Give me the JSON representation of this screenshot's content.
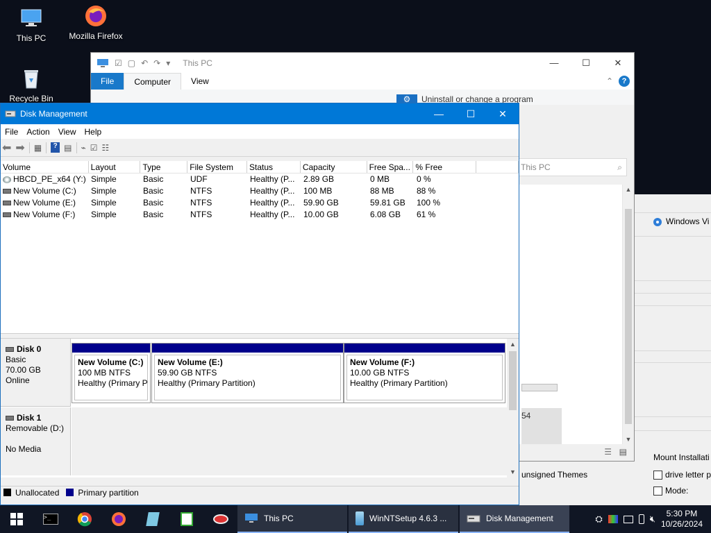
{
  "desktop": {
    "icons": [
      {
        "label": "This PC"
      },
      {
        "label": "Mozilla Firefox"
      },
      {
        "label": "Recycle Bin"
      }
    ]
  },
  "explorer": {
    "title": "This PC",
    "ribbon_tabs": [
      "File",
      "Computer",
      "View"
    ],
    "uninstall_label": "Uninstall or change a program",
    "search_placeholder": "This PC",
    "partial_text": "54"
  },
  "winntsetup": {
    "windows_label": "Windows Vi"
  },
  "bg_options": {
    "unsigned_themes": "unsigned Themes",
    "mount_label": "Mount Installati",
    "drive_letter_label": "drive letter p",
    "mode_label": "Mode:"
  },
  "diskmgmt": {
    "title": "Disk Management",
    "menu": [
      "File",
      "Action",
      "View",
      "Help"
    ],
    "columns": [
      "Volume",
      "Layout",
      "Type",
      "File System",
      "Status",
      "Capacity",
      "Free Spa...",
      "% Free",
      ""
    ],
    "volumes": [
      {
        "name": "HBCD_PE_x64 (Y:)",
        "layout": "Simple",
        "type": "Basic",
        "fs": "UDF",
        "status": "Healthy (P...",
        "capacity": "2.89 GB",
        "free": "0 MB",
        "pct": "0 %",
        "icon": "cd"
      },
      {
        "name": "New Volume (C:)",
        "layout": "Simple",
        "type": "Basic",
        "fs": "NTFS",
        "status": "Healthy (P...",
        "capacity": "100 MB",
        "free": "88 MB",
        "pct": "88 %",
        "icon": "drive"
      },
      {
        "name": "New Volume (E:)",
        "layout": "Simple",
        "type": "Basic",
        "fs": "NTFS",
        "status": "Healthy (P...",
        "capacity": "59.90 GB",
        "free": "59.81 GB",
        "pct": "100 %",
        "icon": "drive"
      },
      {
        "name": "New Volume (F:)",
        "layout": "Simple",
        "type": "Basic",
        "fs": "NTFS",
        "status": "Healthy (P...",
        "capacity": "10.00 GB",
        "free": "6.08 GB",
        "pct": "61 %",
        "icon": "drive"
      }
    ],
    "disks": [
      {
        "name": "Disk 0",
        "kind": "Basic",
        "size": "70.00 GB",
        "state": "Online",
        "partitions": [
          {
            "name": "New Volume  (C:)",
            "size": "100 MB NTFS",
            "status": "Healthy (Primary P"
          },
          {
            "name": "New Volume  (E:)",
            "size": "59.90 GB NTFS",
            "status": "Healthy (Primary Partition)"
          },
          {
            "name": "New Volume  (F:)",
            "size": "10.00 GB NTFS",
            "status": "Healthy (Primary Partition)"
          }
        ]
      },
      {
        "name": "Disk 1",
        "kind": "Removable (D:)",
        "size": "",
        "state": "No Media"
      }
    ],
    "legend": [
      {
        "label": "Unallocated",
        "color": "#000000"
      },
      {
        "label": "Primary partition",
        "color": "#00008b"
      }
    ]
  },
  "taskbar": {
    "apps": [
      {
        "label": "This PC"
      },
      {
        "label": "WinNTSetup 4.6.3 ..."
      },
      {
        "label": "Disk Management"
      }
    ],
    "time": "5:30 PM",
    "date": "10/26/2024"
  },
  "colors": {
    "accent": "#0078d7",
    "primary_partition": "#00008b",
    "taskbar": "#101624"
  }
}
